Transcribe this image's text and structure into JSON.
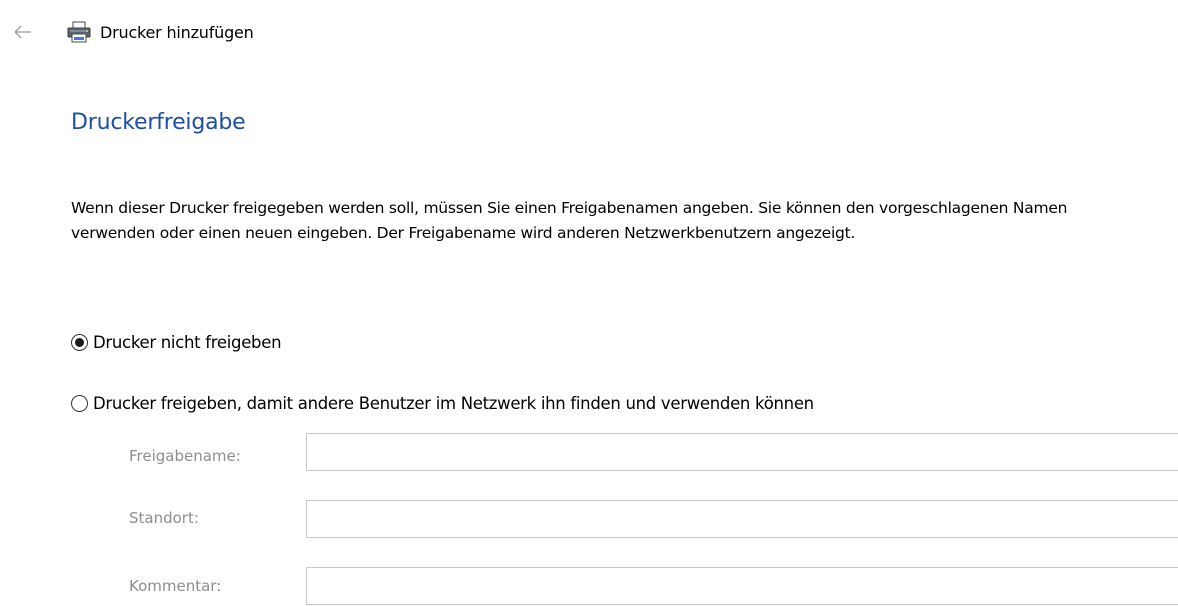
{
  "header": {
    "back_icon": "back-arrow-icon",
    "printer_icon": "printer-icon",
    "title": "Drucker hinzufügen"
  },
  "main": {
    "heading": "Druckerfreigabe",
    "description": "Wenn dieser Drucker freigegeben werden soll, müssen Sie einen Freigabenamen angeben. Sie können den vorgeschlagenen Namen verwenden oder einen neuen eingeben. Der Freigabename wird anderen Netzwerkbenutzern angezeigt.",
    "options": [
      {
        "label": "Drucker nicht freigeben",
        "selected": true
      },
      {
        "label": "Drucker freigeben, damit andere Benutzer im Netzwerk ihn finden und verwenden können",
        "selected": false
      }
    ],
    "fields": [
      {
        "label": "Freigabename:",
        "value": ""
      },
      {
        "label": "Standort:",
        "value": ""
      },
      {
        "label": "Kommentar:",
        "value": ""
      }
    ]
  },
  "colors": {
    "heading": "#1e4fa3",
    "disabled_label": "#8e8e8e",
    "input_border": "#c9c9c9"
  }
}
